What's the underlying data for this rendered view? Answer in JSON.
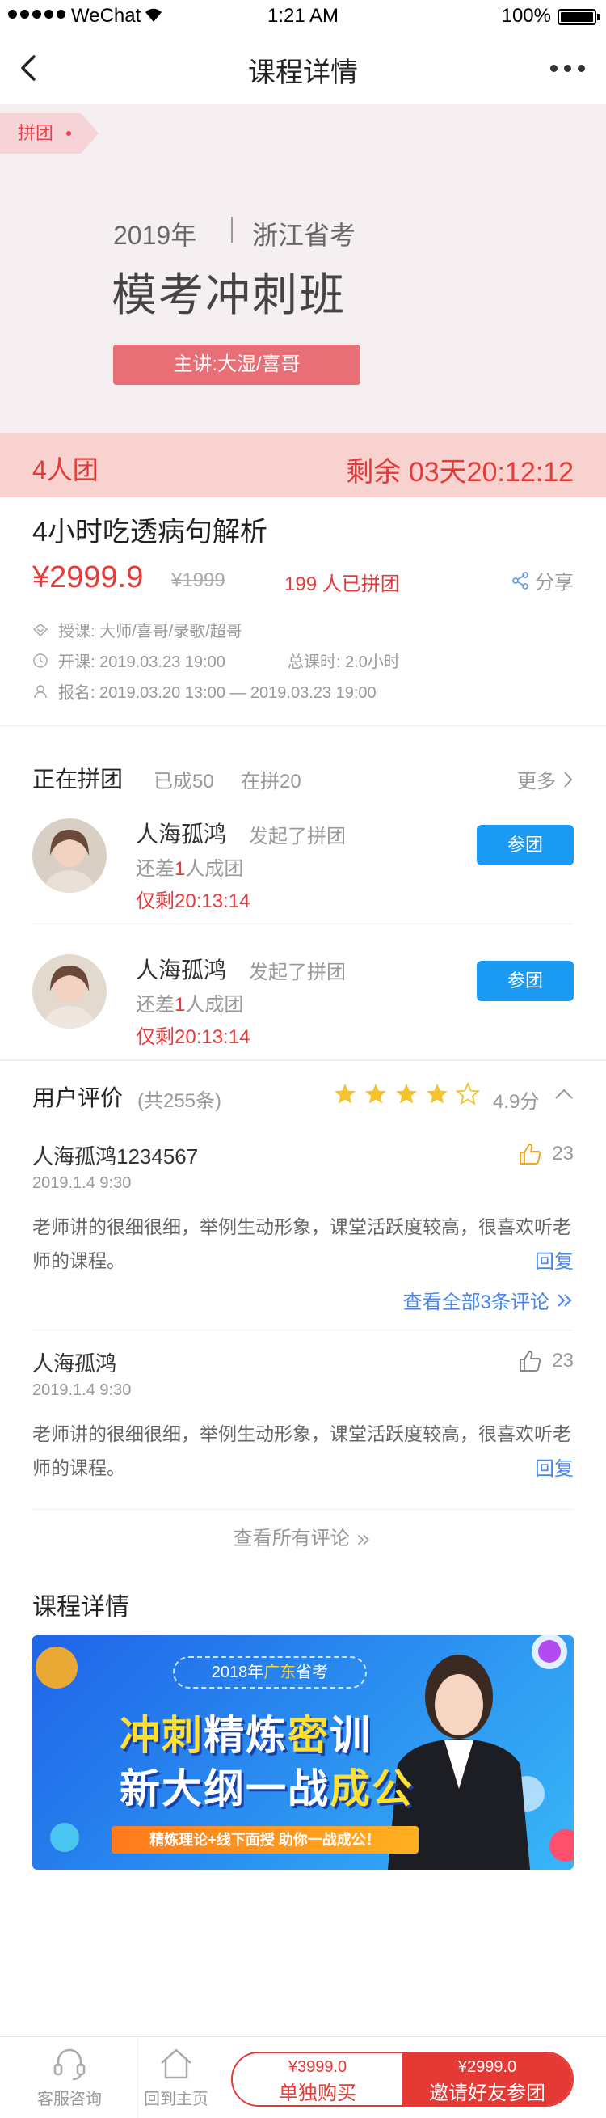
{
  "status": {
    "carrier": "WeChat",
    "time": "1:21 AM",
    "battery": "100%"
  },
  "nav": {
    "title": "课程详情"
  },
  "hero": {
    "badge": "拼团",
    "year": "2019年",
    "exam": "浙江省考",
    "course": "模考冲刺班",
    "lecturer": "主讲:大湿/喜哥"
  },
  "group_bar": {
    "size": "4人团",
    "remaining": "剩余 03天20:12:12"
  },
  "course": {
    "title": "4小时吃透病句解析",
    "price": "¥2999.9",
    "old_price": "¥1999",
    "joined": "199 人已拼团",
    "share": "分享",
    "teachers": "授课: 大师/喜哥/录歌/超哥",
    "start": "开课: 2019.03.23   19:00",
    "total_hours": "总课时:  2.0小时",
    "signup": "报名: 2019.03.20   13:00 — 2019.03.23   19:00"
  },
  "groups": {
    "title": "正在拼团",
    "done": "已成50",
    "ongoing": "在拼20",
    "more": "更多",
    "items": [
      {
        "name": "人海孤鸿",
        "action": "发起了拼团",
        "need_pre": "还差",
        "need_num": "1",
        "need_post": "人成团",
        "left": "仅剩20:13:14",
        "join": "参团"
      },
      {
        "name": "人海孤鸿",
        "action": "发起了拼团",
        "need_pre": "还差",
        "need_num": "1",
        "need_post": "人成团",
        "left": "仅剩20:13:14",
        "join": "参团"
      }
    ]
  },
  "reviews": {
    "title": "用户评价",
    "count": "(共255条)",
    "rating": 4,
    "score": "4.9分",
    "items": [
      {
        "user": "人海孤鸿1234567",
        "date": "2019.1.4    9:30",
        "likes": "23",
        "liked": true,
        "body": "老师讲的很细很细，举例生动形象，课堂活跃度较高，很喜欢听老师的课程。",
        "reply": "回复"
      },
      {
        "user": "人海孤鸿",
        "date": "2019.1.4    9:30",
        "likes": "23",
        "liked": false,
        "body": "老师讲的很细很细，举例生动形象，课堂活跃度较高，很喜欢听老师的课程。",
        "reply": "回复"
      }
    ],
    "view_thread": "查看全部3条评论",
    "view_all": "查看所有评论"
  },
  "details": {
    "title": "课程详情",
    "banner_top_pre": "2018年",
    "banner_top_hl": "广东",
    "banner_top_post": "省考",
    "banner_l1_a": "冲刺",
    "banner_l1_b": "精炼",
    "banner_l1_c": "密",
    "banner_l1_d": "训",
    "banner_l2_a": "新大纲一战",
    "banner_l2_b": "成公",
    "banner_strip": "精炼理论+线下面授   助你一战成公！"
  },
  "bottom": {
    "service": "客服咨询",
    "home": "回到主页",
    "solo_price": "¥3999.0",
    "solo_label": "单独购买",
    "team_price": "¥2999.0",
    "team_label": "邀请好友参团"
  },
  "colors": {
    "accent_red": "#e83a3a",
    "join_blue": "#1a9af3",
    "link_blue": "#4a86e8",
    "star": "#f6c22d"
  }
}
